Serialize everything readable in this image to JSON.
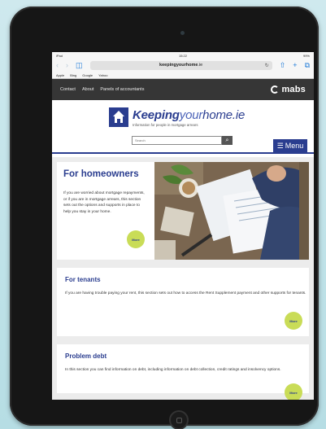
{
  "status_bar": {
    "device": "iPad",
    "time": "15:22",
    "battery": "99%"
  },
  "browser": {
    "url_bold": "keepingyourhome",
    "url_tail": ".ie",
    "bookmarks": [
      "Apple",
      "Bing",
      "Google",
      "Yahoo"
    ]
  },
  "site_nav": {
    "links": [
      "Contact",
      "About",
      "Panels of accountants"
    ],
    "logo": "mabs"
  },
  "header": {
    "brand_part1": "Keeping",
    "brand_part2": "your",
    "brand_part3": "home.ie",
    "tagline": "Information for people in mortgage arrears",
    "search_placeholder": "Search",
    "menu_label": "Menu"
  },
  "cards": [
    {
      "title": "For homeowners",
      "description": "If you are worried about mortgage repayments, or if you are in mortgage arrears, this section sets out the options and supports in place to help you stay in your home.",
      "more_label": "More"
    },
    {
      "title": "For tenants",
      "description": "If you are having trouble paying your rent, this section sets out how to access the Rent Supplement payment and other supports for tenants.",
      "more_label": "More"
    },
    {
      "title": "Problem debt",
      "description": "In this section you can find information on debt, including information on debt collection, credit ratings and insolvency options.",
      "more_label": "More"
    }
  ],
  "colors": {
    "brand": "#2a3d8f",
    "more_button": "#c9dc57",
    "nav_bg": "#363636"
  }
}
